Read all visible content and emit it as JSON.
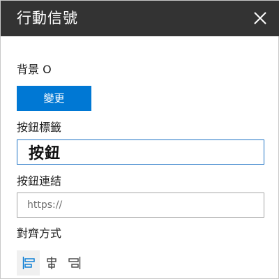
{
  "header": {
    "title": "行動信號",
    "close_icon": "close-icon"
  },
  "background": {
    "label": "背景 O",
    "change_button": "變更"
  },
  "button_label": {
    "label": "按鈕標籤",
    "value": "按鈕"
  },
  "button_link": {
    "label": "按鈕連結",
    "placeholder": "https://"
  },
  "alignment": {
    "label": "對齊方式",
    "options": [
      {
        "icon": "align-left-icon",
        "selected": true
      },
      {
        "icon": "align-center-icon",
        "selected": false
      },
      {
        "icon": "align-right-icon",
        "selected": false
      }
    ]
  },
  "colors": {
    "header_bg": "#333333",
    "accent": "#0078d4"
  }
}
